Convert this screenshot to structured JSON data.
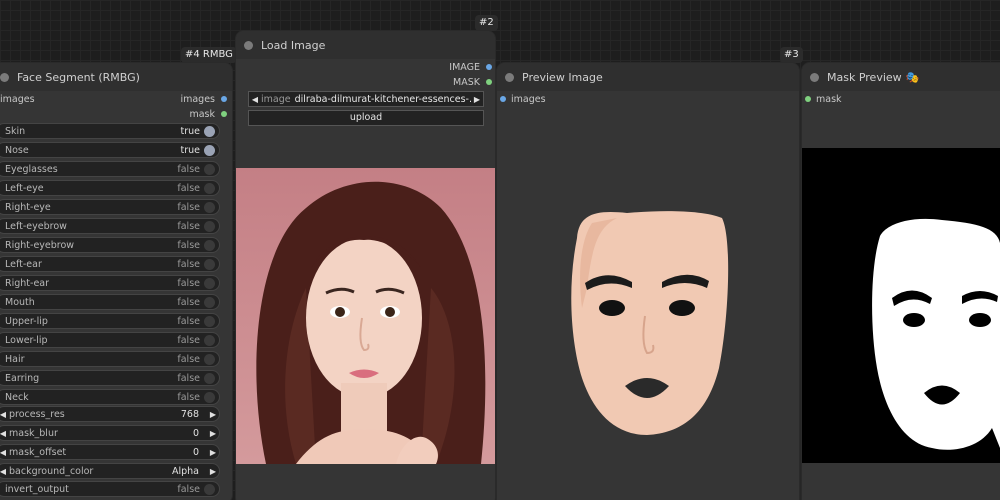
{
  "colors": {
    "canvas_bg": "#1e1e1e",
    "node_bg": "#353535",
    "node_header_bg": "#2f2f2f",
    "slot_blue": "#6aa7e6",
    "slot_green": "#7fd17f",
    "photo_bg": "#c98a8f"
  },
  "badges": {
    "face_segment": "#4 RMBG",
    "load_image": "#2",
    "preview_image": "#3"
  },
  "face_segment": {
    "title": "Face Segment (RMBG)",
    "input_label": "images",
    "outputs": {
      "images": "images",
      "mask": "mask"
    },
    "toggles": [
      {
        "label": "Skin",
        "value": "true"
      },
      {
        "label": "Nose",
        "value": "true"
      },
      {
        "label": "Eyeglasses",
        "value": "false"
      },
      {
        "label": "Left-eye",
        "value": "false"
      },
      {
        "label": "Right-eye",
        "value": "false"
      },
      {
        "label": "Left-eyebrow",
        "value": "false"
      },
      {
        "label": "Right-eyebrow",
        "value": "false"
      },
      {
        "label": "Left-ear",
        "value": "false"
      },
      {
        "label": "Right-ear",
        "value": "false"
      },
      {
        "label": "Mouth",
        "value": "false"
      },
      {
        "label": "Upper-lip",
        "value": "false"
      },
      {
        "label": "Lower-lip",
        "value": "false"
      },
      {
        "label": "Hair",
        "value": "false"
      },
      {
        "label": "Earring",
        "value": "false"
      },
      {
        "label": "Neck",
        "value": "false"
      }
    ],
    "number_widgets": [
      {
        "label": "process_res",
        "value": "768"
      },
      {
        "label": "mask_blur",
        "value": "0"
      },
      {
        "label": "mask_offset",
        "value": "0"
      },
      {
        "label": "background_color",
        "value": "Alpha"
      }
    ],
    "invert_output": {
      "label": "invert_output",
      "value": "false"
    }
  },
  "load_image": {
    "title": "Load Image",
    "outputs": {
      "image": "IMAGE",
      "mask": "MASK"
    },
    "image_combo": {
      "label": "image",
      "value": "dilraba-dilmurat-kitchener-essences-..."
    },
    "upload_label": "upload"
  },
  "preview_image": {
    "title": "Preview Image",
    "input_label": "images"
  },
  "mask_preview": {
    "title": "Mask Preview",
    "title_icon": "🎭",
    "input_label": "mask"
  }
}
